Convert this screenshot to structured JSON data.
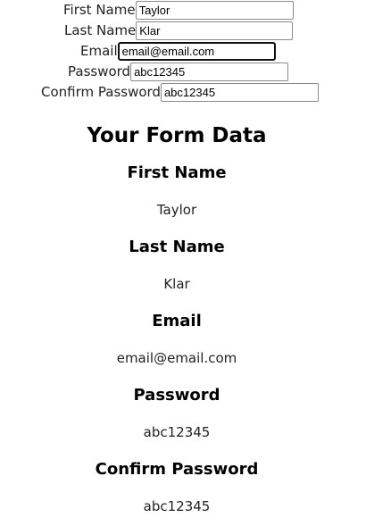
{
  "form": {
    "fields": [
      {
        "label": "First Name",
        "value": "Taylor"
      },
      {
        "label": "Last Name",
        "value": "Klar"
      },
      {
        "label": "Email",
        "value": "email@email.com"
      },
      {
        "label": "Password",
        "value": "abc12345"
      },
      {
        "label": "Confirm Password",
        "value": "abc12345"
      }
    ]
  },
  "results": {
    "heading": "Your Form Data",
    "items": [
      {
        "label": "First Name",
        "value": "Taylor"
      },
      {
        "label": "Last Name",
        "value": "Klar"
      },
      {
        "label": "Email",
        "value": "email@email.com"
      },
      {
        "label": "Password",
        "value": "abc12345"
      },
      {
        "label": "Confirm Password",
        "value": "abc12345"
      }
    ]
  }
}
